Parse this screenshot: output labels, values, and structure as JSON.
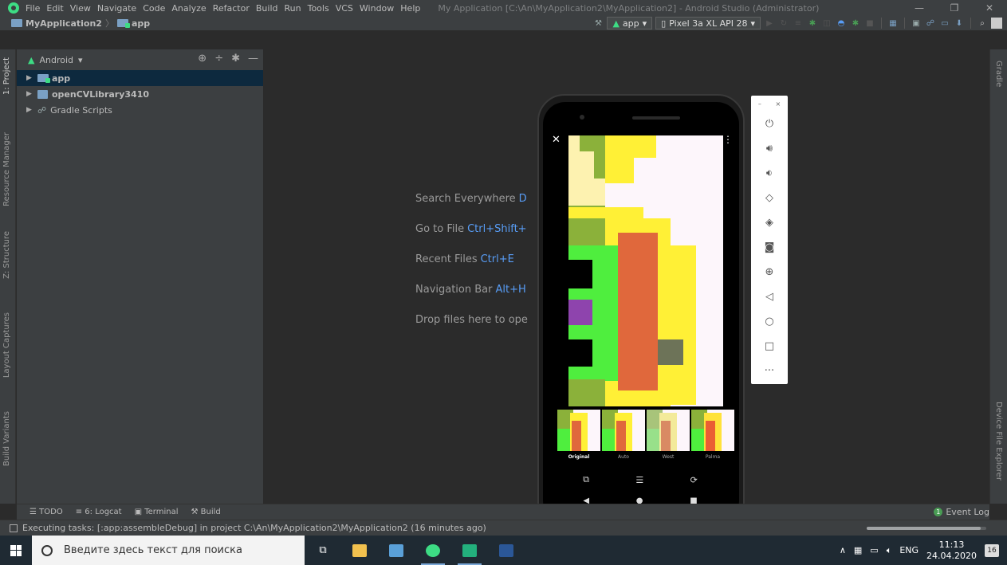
{
  "menu": {
    "items": [
      "File",
      "Edit",
      "View",
      "Navigate",
      "Code",
      "Analyze",
      "Refactor",
      "Build",
      "Run",
      "Tools",
      "VCS",
      "Window",
      "Help"
    ],
    "window_title": "My Application [C:\\An\\MyApplication2\\MyApplication2] - Android Studio (Administrator)"
  },
  "breadcrumb": {
    "project": "MyApplication2",
    "module": "app"
  },
  "toolbar": {
    "config": "app",
    "device": "Pixel 3a XL API 28"
  },
  "left_tabs": [
    "1: Project",
    "Resource Manager",
    "Z: Structure",
    "Layout Captures",
    "Build Variants"
  ],
  "right_tabs": [
    "Gradle",
    "Device File Explorer"
  ],
  "project_panel": {
    "view_mode": "Android",
    "tree": [
      {
        "label": "app",
        "bold": true,
        "selected": true
      },
      {
        "label": "openCVLibrary3410",
        "bold": true,
        "selected": false
      },
      {
        "label": "Gradle Scripts",
        "bold": false,
        "selected": false
      }
    ]
  },
  "hints": [
    {
      "text": "Search Everywhere",
      "key": "D"
    },
    {
      "text": "Go to File",
      "key": "Ctrl+Shift+"
    },
    {
      "text": "Recent Files",
      "key": "Ctrl+E"
    },
    {
      "text": "Navigation Bar",
      "key": "Alt+H"
    },
    {
      "text": "Drop files here to ope",
      "key": ""
    }
  ],
  "bottom_tabs": [
    "TODO",
    "6: Logcat",
    "Terminal",
    "Build"
  ],
  "event_log": {
    "label": "Event Log",
    "count": "1"
  },
  "status": {
    "message": "Executing tasks: [:app:assembleDebug] in project C:\\An\\MyApplication2\\MyApplication2 (16 minutes ago)",
    "progress": 0.95
  },
  "phone": {
    "filters": [
      {
        "label": "Original",
        "selected": true
      },
      {
        "label": "Auto",
        "selected": false
      },
      {
        "label": "West",
        "selected": false
      },
      {
        "label": "Palma",
        "selected": false
      }
    ]
  },
  "taskbar": {
    "search_placeholder": "Введите здесь текст для поиска",
    "lang": "ENG",
    "time": "11:13",
    "date": "24.04.2020",
    "notifications": "16"
  },
  "colors": {
    "accent": "#589df6",
    "android_green": "#3ddc84",
    "selection": "#0d293e"
  }
}
